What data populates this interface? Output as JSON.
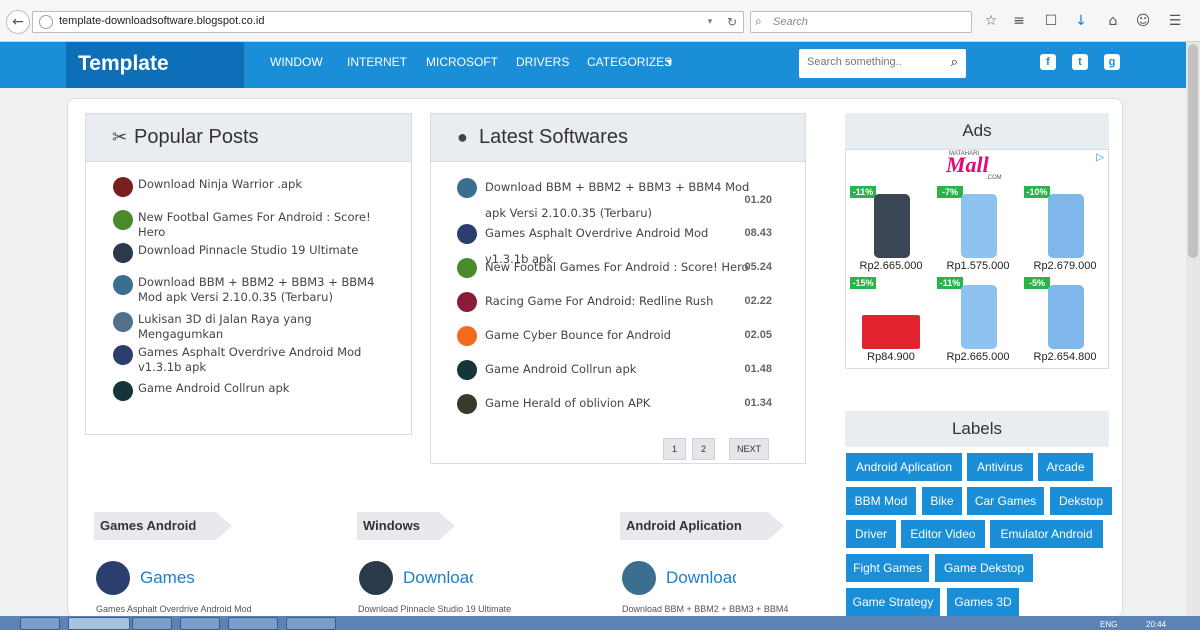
{
  "browser": {
    "url": "template-downloadsoftware.blogspot.co.id",
    "search_placeholder": "Search"
  },
  "site": {
    "brand": "Template",
    "menu": [
      "WINDOW",
      "INTERNET",
      "MICROSOFT",
      "DRIVERS",
      "CATEGORIZES"
    ],
    "menu_dropdown_icon": "caret-down-icon",
    "search_placeholder": "Search something..",
    "social": [
      "facebook-icon",
      "twitter-icon",
      "google-plus-icon"
    ]
  },
  "popular_posts": {
    "title": "Popular Posts",
    "items": [
      "Download Ninja Warrior .apk",
      "New Footbal Games For Android : Score! Hero",
      "Download Pinnacle Studio 19 Ultimate",
      "Download BBM + BBM2 + BBM3 + BBM4 Mod apk Versi 2.10.0.35 (Terbaru)",
      "Lukisan 3D di Jalan Raya yang Mengagumkan",
      "Games Asphalt Overdrive Android Mod v1.3.1b apk",
      "Game Android Collrun apk"
    ]
  },
  "latest_softwares": {
    "title": "Latest Softwares",
    "items": [
      {
        "title": "Download BBM + BBM2 + BBM3 + BBM4 Mod apk Versi 2.10.0.35 (Terbaru)",
        "time": "01.20"
      },
      {
        "title": "Games Asphalt Overdrive Android Mod v1.3.1b apk",
        "time": "08.43"
      },
      {
        "title": "New Footbal Games For Android : Score! Hero",
        "time": "05.24"
      },
      {
        "title": "Racing Game For Android: Redline Rush",
        "time": "02.22"
      },
      {
        "title": "Game Cyber Bounce for Android",
        "time": "02.05"
      },
      {
        "title": "Game Android Collrun apk",
        "time": "01.48"
      },
      {
        "title": "Game Herald of oblivion APK",
        "time": "01.34"
      }
    ],
    "pagination": [
      "1",
      "2",
      "NEXT"
    ]
  },
  "ads": {
    "title": "Ads",
    "brand_small": "MATAHARI",
    "brand": "Mall",
    "brand_suffix": ".COM",
    "products": [
      {
        "discount": "-11%",
        "price": "Rp2.665.000"
      },
      {
        "discount": "-7%",
        "price": "Rp1.575.000"
      },
      {
        "discount": "-10%",
        "price": "Rp2.679.000"
      },
      {
        "discount": "-15%",
        "price": "Rp84.900"
      },
      {
        "discount": "-11%",
        "price": "Rp2.665.000"
      },
      {
        "discount": "-5%",
        "price": "Rp2.654.800"
      }
    ]
  },
  "labels": {
    "title": "Labels",
    "tags": [
      "Android Aplication",
      "Antivirus",
      "Arcade",
      "BBM Mod",
      "Bike",
      "Car Games",
      "Dekstop",
      "Driver",
      "Editor Video",
      "Emulator Android",
      "Fight Games",
      "Game Dekstop",
      "Game Strategy",
      "Games 3D"
    ]
  },
  "categories": [
    {
      "label": "Games Android",
      "link": "Games",
      "desc": "Games Asphalt Overdrive Android Mod"
    },
    {
      "label": "Windows",
      "link": "Download",
      "desc": "Download Pinnacle Studio 19 Ultimate"
    },
    {
      "label": "Android Aplication",
      "link": "Download",
      "desc": "Download BBM + BBM2 + BBM3 + BBM4"
    }
  ],
  "taskbar": {
    "lang": "ENG",
    "time": "20:44"
  },
  "colors": {
    "brand_blue": "#1a8fd8",
    "brand_dark": "#0d6fb8",
    "discount_green": "#2ab34a"
  }
}
